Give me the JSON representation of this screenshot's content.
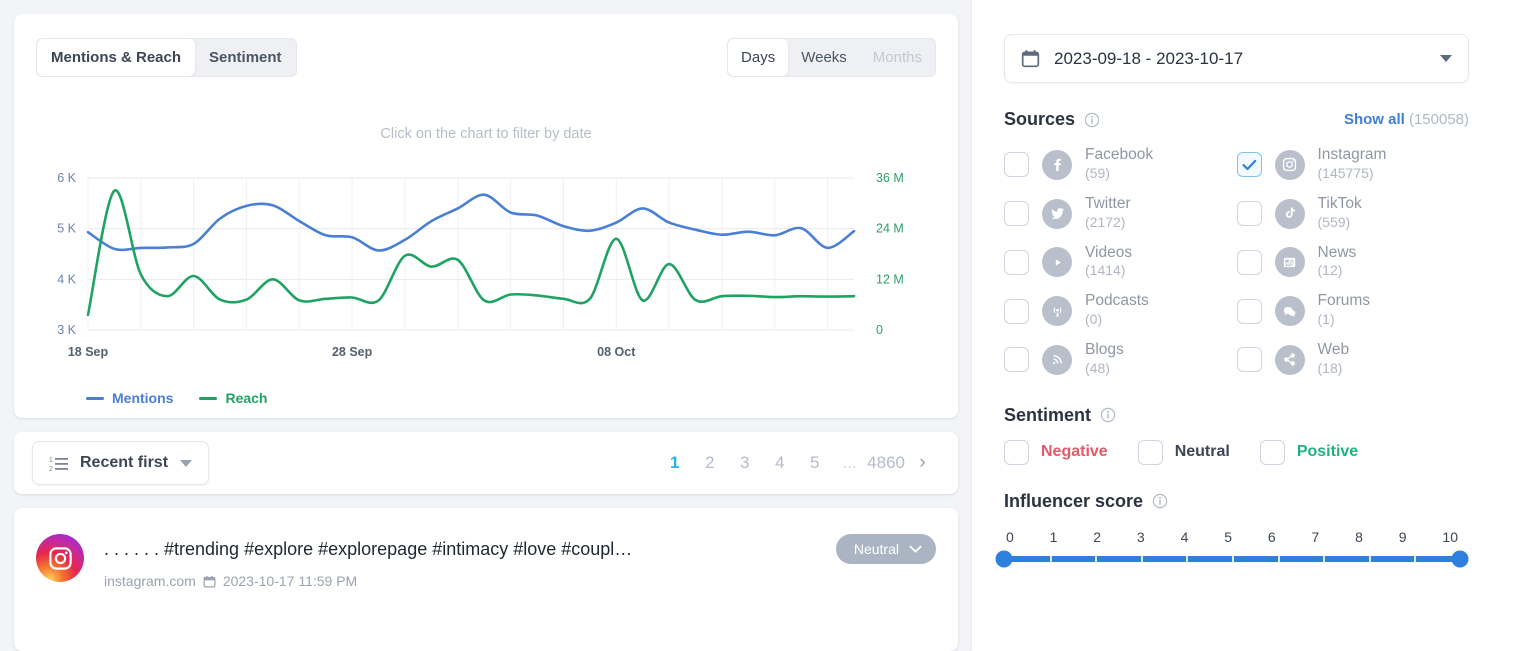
{
  "chart_panel": {
    "view_tabs": [
      {
        "label": "Mentions & Reach",
        "active": true
      },
      {
        "label": "Sentiment",
        "active": false
      }
    ],
    "granularity_tabs": [
      {
        "label": "Days",
        "active": true,
        "disabled": false
      },
      {
        "label": "Weeks",
        "active": false,
        "disabled": false
      },
      {
        "label": "Months",
        "active": false,
        "disabled": true
      }
    ],
    "hint": "Click on the chart to filter by date"
  },
  "chart_data": {
    "type": "line",
    "title": "",
    "xlabel": "",
    "ylabel": "Mentions",
    "y2label": "Reach",
    "grid": true,
    "legend_position": "bottom-left",
    "x_ticks": [
      "18 Sep",
      "28 Sep",
      "08 Oct"
    ],
    "x_tick_positions": [
      0,
      10,
      20
    ],
    "y_ticks": [
      "3 K",
      "4 K",
      "5 K",
      "6 K"
    ],
    "y_tick_values": [
      3000,
      4000,
      5000,
      6000
    ],
    "ylim": [
      3000,
      6000
    ],
    "y2_ticks": [
      "0",
      "12 M",
      "24 M",
      "36 M"
    ],
    "y2_tick_values": [
      0,
      12000000,
      24000000,
      36000000
    ],
    "y2lim": [
      0,
      36000000
    ],
    "x": [
      "2023-09-18",
      "2023-09-19",
      "2023-09-20",
      "2023-09-21",
      "2023-09-22",
      "2023-09-23",
      "2023-09-24",
      "2023-09-25",
      "2023-09-26",
      "2023-09-27",
      "2023-09-28",
      "2023-09-29",
      "2023-09-30",
      "2023-10-01",
      "2023-10-02",
      "2023-10-03",
      "2023-10-04",
      "2023-10-05",
      "2023-10-06",
      "2023-10-07",
      "2023-10-08",
      "2023-10-09",
      "2023-10-10",
      "2023-10-11",
      "2023-10-12",
      "2023-10-13",
      "2023-10-14",
      "2023-10-15",
      "2023-10-16",
      "2023-10-17"
    ],
    "series": [
      {
        "name": "Mentions",
        "color": "#4a7fd4",
        "axis": "left",
        "values": [
          4930,
          4600,
          4620,
          4630,
          4700,
          5200,
          5450,
          5460,
          5150,
          4870,
          4830,
          4570,
          4780,
          5150,
          5400,
          5670,
          5320,
          5260,
          5050,
          4960,
          5120,
          5400,
          5120,
          4980,
          4880,
          4940,
          4870,
          5010,
          4620,
          4950
        ]
      },
      {
        "name": "Reach",
        "color": "#1fa363",
        "axis": "right",
        "values": [
          3600000,
          33000000,
          13200000,
          8000000,
          12800000,
          7200000,
          7200000,
          12000000,
          7000000,
          7400000,
          7700000,
          7000000,
          17600000,
          15000000,
          16600000,
          7000000,
          8400000,
          8200000,
          7400000,
          7400000,
          21600000,
          7000000,
          15600000,
          7100000,
          8000000,
          8100000,
          7800000,
          8000000,
          7900000,
          8000000
        ]
      }
    ],
    "legend": [
      {
        "label": "Mentions",
        "color": "#4a7fd4"
      },
      {
        "label": "Reach",
        "color": "#1fa363"
      }
    ]
  },
  "list_controls": {
    "sort_label": "Recent first",
    "pages": [
      {
        "label": "1",
        "active": true
      },
      {
        "label": "2",
        "active": false
      },
      {
        "label": "3",
        "active": false
      },
      {
        "label": "4",
        "active": false
      },
      {
        "label": "5",
        "active": false
      },
      {
        "label": "...",
        "active": false,
        "dots": true
      },
      {
        "label": "4860",
        "active": false
      }
    ],
    "next_label": "›"
  },
  "results": [
    {
      "avatar": "instagram-icon",
      "title": ". . . . . . #trending #explore #explorepage #intimacy #love #coupl…",
      "source": "instagram.com",
      "date": "2023-10-17 11:59 PM",
      "sentiment": "Neutral"
    }
  ],
  "filters": {
    "date_range": "2023-09-18 - 2023-10-17",
    "sources": {
      "title": "Sources",
      "show_all_label": "Show all",
      "show_all_count": "(150058)",
      "items": [
        {
          "name": "Facebook",
          "count": "(59)",
          "icon": "facebook-icon",
          "checked": false
        },
        {
          "name": "Instagram",
          "count": "(145775)",
          "icon": "instagram-icon",
          "checked": true
        },
        {
          "name": "Twitter",
          "count": "(2172)",
          "icon": "twitter-icon",
          "checked": false
        },
        {
          "name": "TikTok",
          "count": "(559)",
          "icon": "tiktok-icon",
          "checked": false
        },
        {
          "name": "Videos",
          "count": "(1414)",
          "icon": "video-icon",
          "checked": false
        },
        {
          "name": "News",
          "count": "(12)",
          "icon": "news-icon",
          "checked": false
        },
        {
          "name": "Podcasts",
          "count": "(0)",
          "icon": "podcast-icon",
          "checked": false
        },
        {
          "name": "Forums",
          "count": "(1)",
          "icon": "forum-icon",
          "checked": false
        },
        {
          "name": "Blogs",
          "count": "(48)",
          "icon": "rss-icon",
          "checked": false
        },
        {
          "name": "Web",
          "count": "(18)",
          "icon": "share-icon",
          "checked": false
        }
      ]
    },
    "sentiment": {
      "title": "Sentiment",
      "items": [
        {
          "label": "Negative",
          "color": "#e05a6b",
          "checked": false
        },
        {
          "label": "Neutral",
          "color": "#3c4654",
          "checked": false
        },
        {
          "label": "Positive",
          "color": "#22b07d",
          "checked": false
        }
      ]
    },
    "influencer": {
      "title": "Influencer score",
      "ticks": [
        "0",
        "1",
        "2",
        "3",
        "4",
        "5",
        "6",
        "7",
        "8",
        "9",
        "10"
      ],
      "min": 0,
      "max": 10,
      "value_low": 0,
      "value_high": 10
    }
  }
}
